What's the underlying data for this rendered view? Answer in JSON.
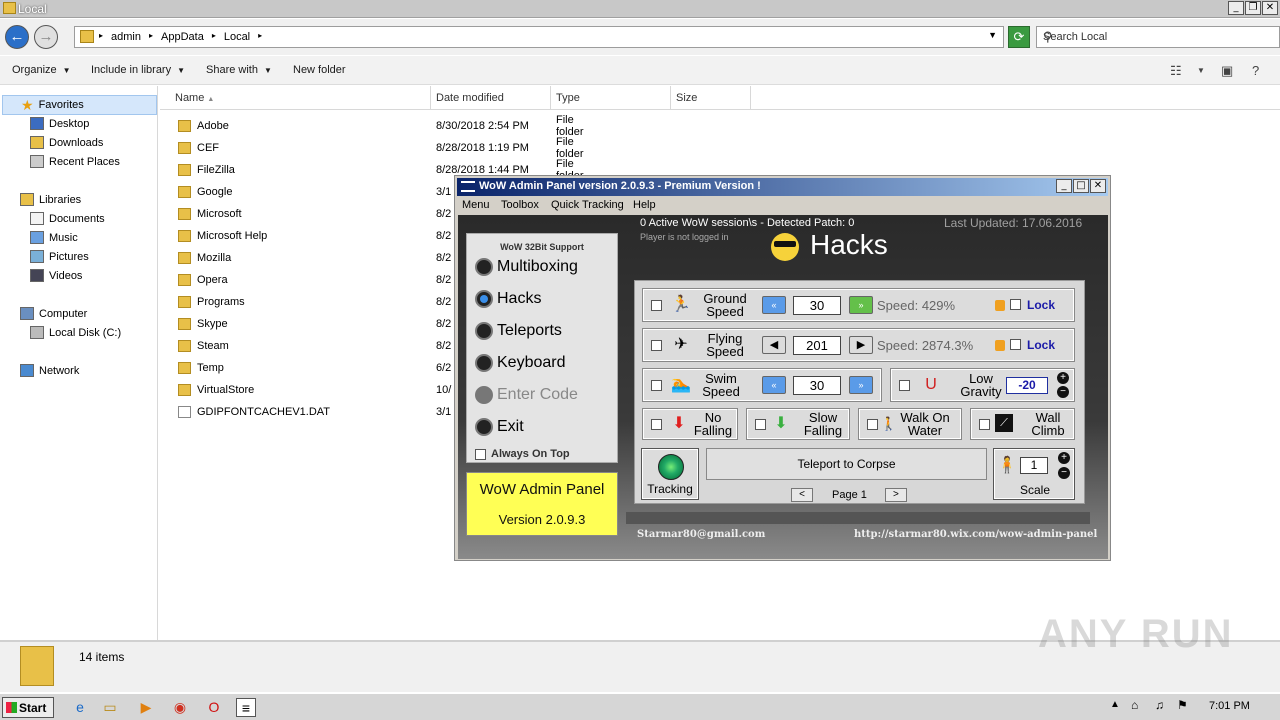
{
  "explorer": {
    "title": "Local",
    "breadcrumbs": [
      "admin",
      "AppData",
      "Local"
    ],
    "search_placeholder": "Search Local",
    "commands": {
      "organize": "Organize",
      "include": "Include in library",
      "share": "Share with",
      "new_folder": "New folder"
    },
    "nav": {
      "favorites": "Favorites",
      "desktop": "Desktop",
      "downloads": "Downloads",
      "recent": "Recent Places",
      "libraries": "Libraries",
      "documents": "Documents",
      "music": "Music",
      "pictures": "Pictures",
      "videos": "Videos",
      "computer": "Computer",
      "local_disk": "Local Disk (C:)",
      "network": "Network"
    },
    "columns": {
      "name": "Name",
      "date": "Date modified",
      "type": "Type",
      "size": "Size"
    },
    "files": [
      {
        "name": "Adobe",
        "date": "8/30/2018 2:54 PM",
        "type": "File folder"
      },
      {
        "name": "CEF",
        "date": "8/28/2018 1:19 PM",
        "type": "File folder"
      },
      {
        "name": "FileZilla",
        "date": "8/28/2018 1:44 PM",
        "type": "File folder"
      },
      {
        "name": "Google",
        "date": "3/1",
        "type": ""
      },
      {
        "name": "Microsoft",
        "date": "8/2",
        "type": ""
      },
      {
        "name": "Microsoft Help",
        "date": "8/2",
        "type": ""
      },
      {
        "name": "Mozilla",
        "date": "8/2",
        "type": ""
      },
      {
        "name": "Opera",
        "date": "8/2",
        "type": ""
      },
      {
        "name": "Programs",
        "date": "8/2",
        "type": ""
      },
      {
        "name": "Skype",
        "date": "8/2",
        "type": ""
      },
      {
        "name": "Steam",
        "date": "8/2",
        "type": ""
      },
      {
        "name": "Temp",
        "date": "6/2",
        "type": ""
      },
      {
        "name": "VirtualStore",
        "date": "10/",
        "type": ""
      },
      {
        "name": "GDIPFONTCACHEV1.DAT",
        "date": "3/1",
        "type": ""
      }
    ],
    "status_count": "14 items"
  },
  "wow": {
    "title": "WoW Admin Panel version 2.0.9.3 - Premium Version !",
    "menu": [
      "Menu",
      "Toolbox",
      "Quick Tracking",
      "Help"
    ],
    "session": "0 Active WoW session\\s - Detected Patch: 0",
    "login_status": "Player is not logged in",
    "last_updated": "Last Updated: 17.06.2016",
    "section_title": "Hacks",
    "support_header": "WoW 32Bit Support",
    "nav": {
      "multiboxing": "Multiboxing",
      "hacks": "Hacks",
      "teleports": "Teleports",
      "keyboard": "Keyboard",
      "enter_code": "Enter Code",
      "exit": "Exit"
    },
    "always_on_top": "Always On Top",
    "logo_line1": "WoW Admin Panel",
    "logo_line2": "Version 2.0.9.3",
    "ground": {
      "l1": "Ground",
      "l2": "Speed",
      "value": "30",
      "speed": "Speed:   429%",
      "lock": "Lock"
    },
    "flying": {
      "l1": "Flying",
      "l2": "Speed",
      "value": "201",
      "speed": "Speed: 2874.3%",
      "lock": "Lock"
    },
    "swim": {
      "l1": "Swim",
      "l2": "Speed",
      "value": "30"
    },
    "gravity": {
      "l1": "Low",
      "l2": "Gravity",
      "value": "-20"
    },
    "nofall": {
      "l1": "No",
      "l2": "Falling"
    },
    "slowfall": {
      "l1": "Slow",
      "l2": "Falling"
    },
    "walkwater": {
      "l1": "Walk On",
      "l2": "Water"
    },
    "wallclimb": {
      "l1": "Wall",
      "l2": "Climb"
    },
    "tracking": "Tracking",
    "teleport_corpse": "Teleport to Corpse",
    "page": "Page 1",
    "prev": "<",
    "next": ">",
    "scale_value": "1",
    "scale_label": "Scale",
    "email": "Starmar80@gmail.com",
    "url": "http://starmar80.wix.com/wow-admin-panel"
  },
  "taskbar": {
    "start": "Start",
    "time": "7:01 PM"
  },
  "watermark": "ANY RUN"
}
